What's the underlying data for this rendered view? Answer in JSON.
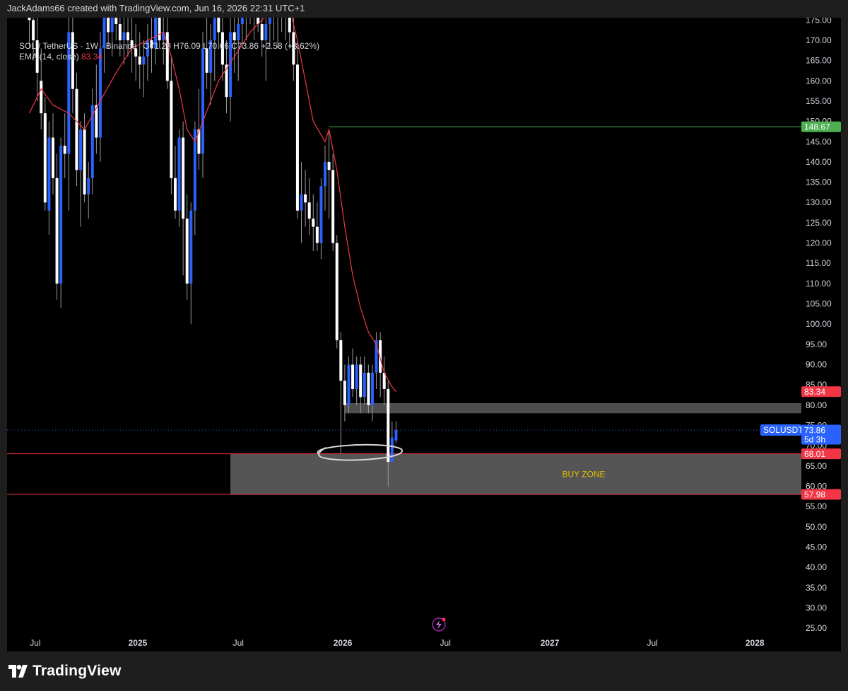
{
  "header": {
    "attribution": "JackAdams66 created with TradingView.com, Jun 16, 2026 22:31 UTC+1"
  },
  "legend": {
    "symbol": "SOL / TetherUS · 1W · Binance",
    "open": "O71.29",
    "high": "H76.09",
    "low": "L70.66",
    "close": "C73.86",
    "change": "+2.58 (+3.62%)",
    "ema_label": "EMA (14, close)",
    "ema_value": "83.34"
  },
  "colors": {
    "background": "#000000",
    "candle_up": "#2962ff",
    "candle_down": "#ffffff",
    "ema": "#f23645",
    "resistance_line": "#4caf50",
    "buy_zone_line": "#f23645",
    "zone_fill": "#5a5a5a",
    "buy_zone_text": "#e5c100"
  },
  "footer": {
    "brand": "TradingView"
  },
  "chart_data": {
    "type": "candlestick",
    "symbol": "SOLUSDT",
    "interval": "1W",
    "ylim": [
      22,
      177
    ],
    "y_ticks": [
      "175.00",
      "170.00",
      "165.00",
      "160.00",
      "155.00",
      "150.00",
      "145.00",
      "140.00",
      "135.00",
      "130.00",
      "125.00",
      "120.00",
      "115.00",
      "110.00",
      "105.00",
      "100.00",
      "95.00",
      "90.00",
      "85.00",
      "80.00",
      "75.00",
      "70.00",
      "65.00",
      "60.00",
      "55.00",
      "50.00",
      "45.00",
      "40.00",
      "35.00",
      "30.00",
      "25.00"
    ],
    "x_ticks": [
      {
        "label": "Jul",
        "week": 1.5,
        "bold": false
      },
      {
        "label": "2025",
        "week": 27.5,
        "bold": true
      },
      {
        "label": "Jul",
        "week": 53,
        "bold": false
      },
      {
        "label": "2026",
        "week": 79.5,
        "bold": true
      },
      {
        "label": "Jul",
        "week": 105.5,
        "bold": false
      },
      {
        "label": "2027",
        "week": 132,
        "bold": true
      },
      {
        "label": "Jul",
        "week": 158,
        "bold": false
      },
      {
        "label": "2028",
        "week": 184,
        "bold": true
      }
    ],
    "candles": [
      [
        0,
        188,
        196,
        168,
        175
      ],
      [
        1,
        175,
        182,
        165,
        170
      ],
      [
        2,
        170,
        176,
        155,
        162
      ],
      [
        3,
        160,
        168,
        148,
        152
      ],
      [
        4,
        152,
        156,
        128,
        130
      ],
      [
        5,
        128,
        150,
        122,
        146
      ],
      [
        6,
        146,
        152,
        132,
        136
      ],
      [
        7,
        136,
        142,
        106,
        110
      ],
      [
        8,
        110,
        146,
        104,
        144
      ],
      [
        9,
        144,
        152,
        136,
        142
      ],
      [
        10,
        142,
        176,
        128,
        172
      ],
      [
        11,
        172,
        178,
        152,
        158
      ],
      [
        12,
        158,
        162,
        134,
        138
      ],
      [
        13,
        138,
        150,
        124,
        148
      ],
      [
        14,
        148,
        152,
        130,
        132
      ],
      [
        15,
        132,
        140,
        126,
        136
      ],
      [
        16,
        136,
        158,
        132,
        154
      ],
      [
        17,
        154,
        164,
        142,
        146
      ],
      [
        18,
        146,
        172,
        140,
        168
      ],
      [
        19,
        168,
        180,
        162,
        176
      ],
      [
        20,
        176,
        182,
        168,
        172
      ],
      [
        21,
        172,
        180,
        166,
        176
      ],
      [
        22,
        176,
        182,
        170,
        174
      ],
      [
        23,
        174,
        180,
        166,
        170
      ],
      [
        24,
        170,
        176,
        164,
        172
      ],
      [
        25,
        172,
        178,
        166,
        170
      ],
      [
        26,
        170,
        176,
        162,
        168
      ],
      [
        27,
        168,
        174,
        160,
        166
      ],
      [
        28,
        166,
        172,
        158,
        164
      ],
      [
        29,
        164,
        170,
        156,
        166
      ],
      [
        30,
        166,
        174,
        160,
        170
      ],
      [
        31,
        170,
        176,
        162,
        168
      ],
      [
        32,
        168,
        180,
        164,
        178
      ],
      [
        33,
        178,
        182,
        168,
        170
      ],
      [
        34,
        170,
        180,
        164,
        172
      ],
      [
        35,
        172,
        176,
        158,
        160
      ],
      [
        36,
        160,
        166,
        132,
        136
      ],
      [
        37,
        136,
        144,
        126,
        128
      ],
      [
        38,
        128,
        148,
        124,
        146
      ],
      [
        39,
        146,
        150,
        112,
        126
      ],
      [
        40,
        126,
        132,
        106,
        110
      ],
      [
        41,
        110,
        130,
        100,
        128
      ],
      [
        42,
        128,
        150,
        122,
        148
      ],
      [
        43,
        148,
        158,
        138,
        142
      ],
      [
        44,
        142,
        172,
        136,
        168
      ],
      [
        45,
        168,
        176,
        158,
        162
      ],
      [
        46,
        162,
        174,
        154,
        170
      ],
      [
        47,
        170,
        180,
        160,
        176
      ],
      [
        48,
        176,
        182,
        168,
        172
      ],
      [
        49,
        172,
        178,
        160,
        164
      ],
      [
        50,
        164,
        170,
        152,
        156
      ],
      [
        51,
        156,
        176,
        150,
        172
      ],
      [
        52,
        172,
        180,
        162,
        170
      ],
      [
        53,
        170,
        178,
        160,
        174
      ],
      [
        54,
        174,
        182,
        168,
        178
      ],
      [
        55,
        178,
        186,
        170,
        180
      ],
      [
        56,
        180,
        188,
        174,
        176
      ],
      [
        57,
        176,
        184,
        170,
        180
      ],
      [
        58,
        180,
        186,
        172,
        174
      ],
      [
        59,
        174,
        180,
        166,
        170
      ],
      [
        60,
        170,
        178,
        160,
        174
      ],
      [
        61,
        174,
        182,
        168,
        178
      ],
      [
        62,
        178,
        184,
        170,
        176
      ],
      [
        63,
        176,
        182,
        168,
        180
      ],
      [
        64,
        180,
        186,
        172,
        178
      ],
      [
        65,
        178,
        184,
        170,
        176
      ],
      [
        66,
        176,
        182,
        168,
        172
      ],
      [
        67,
        172,
        178,
        160,
        164
      ],
      [
        68,
        164,
        170,
        126,
        128
      ],
      [
        69,
        128,
        140,
        120,
        132
      ],
      [
        70,
        132,
        138,
        124,
        130
      ],
      [
        71,
        130,
        136,
        122,
        126
      ],
      [
        72,
        126,
        132,
        118,
        124
      ],
      [
        73,
        124,
        130,
        118,
        120
      ],
      [
        74,
        120,
        136,
        116,
        134
      ],
      [
        75,
        134,
        144,
        128,
        140
      ],
      [
        76,
        140,
        148,
        126,
        138
      ],
      [
        77,
        138,
        142,
        118,
        120
      ],
      [
        78,
        120,
        122,
        94,
        96
      ],
      [
        79,
        96,
        98,
        68,
        86
      ],
      [
        80,
        86,
        90,
        76,
        80
      ],
      [
        81,
        80,
        92,
        78,
        90
      ],
      [
        82,
        90,
        94,
        82,
        84
      ],
      [
        83,
        84,
        92,
        80,
        90
      ],
      [
        84,
        90,
        92,
        78,
        82
      ],
      [
        85,
        82,
        92,
        80,
        88
      ],
      [
        86,
        88,
        90,
        78,
        80
      ],
      [
        87,
        80,
        90,
        76,
        88
      ],
      [
        88,
        88,
        98,
        84,
        96
      ],
      [
        89,
        96,
        98,
        82,
        88
      ],
      [
        90,
        88,
        92,
        80,
        84
      ],
      [
        91,
        84,
        86,
        60,
        66
      ],
      [
        92,
        66,
        76,
        66,
        72
      ],
      [
        93,
        71.29,
        76.09,
        70.66,
        73.86
      ]
    ],
    "ema": {
      "label": "EMA (14, close)",
      "value": 83.34,
      "points": [
        [
          0,
          152
        ],
        [
          3,
          158
        ],
        [
          6,
          154
        ],
        [
          10,
          152
        ],
        [
          14,
          148
        ],
        [
          18,
          155
        ],
        [
          22,
          162
        ],
        [
          26,
          168
        ],
        [
          30,
          170
        ],
        [
          34,
          172
        ],
        [
          36,
          166
        ],
        [
          38,
          158
        ],
        [
          40,
          148
        ],
        [
          42,
          145
        ],
        [
          44,
          150
        ],
        [
          48,
          160
        ],
        [
          52,
          166
        ],
        [
          56,
          172
        ],
        [
          60,
          176
        ],
        [
          64,
          178
        ],
        [
          66,
          178
        ],
        [
          68,
          170
        ],
        [
          70,
          160
        ],
        [
          72,
          150
        ],
        [
          75,
          145
        ],
        [
          76,
          148
        ],
        [
          78,
          138
        ],
        [
          80,
          124
        ],
        [
          82,
          112
        ],
        [
          84,
          104
        ],
        [
          86,
          98
        ],
        [
          88,
          95
        ],
        [
          90,
          88
        ],
        [
          92,
          84.5
        ],
        [
          93,
          83.34
        ]
      ]
    },
    "levels": [
      {
        "name": "resistance",
        "price": 148.67,
        "label": "148.67",
        "start_week": 76
      },
      {
        "name": "buy-zone-top",
        "price": 68.01,
        "label": "68.01"
      },
      {
        "name": "buy-zone-bottom",
        "price": 57.98,
        "label": "57.98"
      }
    ],
    "zones": [
      {
        "name": "buy-zone",
        "top": 68.01,
        "bottom": 57.98,
        "start_week": 51,
        "label": "BUY ZONE"
      },
      {
        "name": "resistance-zone",
        "top": 80.5,
        "bottom": 78.0,
        "start_week": 80,
        "label": ""
      }
    ],
    "annotation": {
      "type": "ellipse",
      "center_week": 84,
      "price": 68.4
    },
    "last_price": {
      "symbol": "SOLUSDT",
      "price": "73.86",
      "countdown": "5d 3h"
    },
    "ema_tag": "83.34",
    "grid": false
  }
}
